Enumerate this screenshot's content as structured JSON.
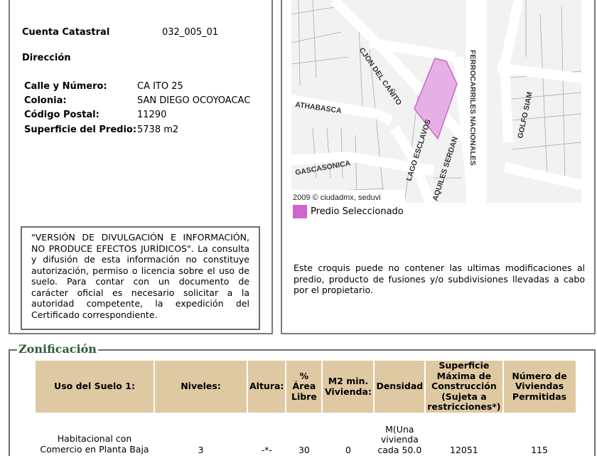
{
  "info": {
    "cuenta_label": "Cuenta Catastral",
    "cuenta_value": "032_005_01",
    "direccion_label": "Dirección",
    "fields": [
      {
        "label": "Calle y Número:",
        "value": "CA ITO 25"
      },
      {
        "label": "Colonia:",
        "value": "SAN DIEGO OCOYOACAC"
      },
      {
        "label": "Código Postal:",
        "value": "11290"
      },
      {
        "label": "Superficie del Predio:",
        "value": "5738 m2"
      }
    ],
    "notice": "\"VERSIÓN DE DIVULGACIÓN E INFORMACIÓN, NO PRODUCE EFECTOS JURÍDICOS\". La consulta y difusión de esta información no constituye autorización, permiso o licencia sobre el uso de suelo. Para contar con un documento de carácter oficial es necesario solicitar a la autoridad competente, la expedición del Certificado correspondiente."
  },
  "map": {
    "streets": [
      "CJON DEL CAÑITO",
      "ATHABASCA",
      "GASCASONICA",
      "LAGO ESCLAVOS",
      "AQUILES SERDAN",
      "FERROCARRILES NACIONALES",
      "GOLFO SIAM"
    ],
    "copyright": "2009 © ciudadmx, seduvi",
    "legend": "Predio Seleccionado",
    "highlight_color": "#cc66cc",
    "disclaimer": "Este croquis puede no contener las ultimas modificaciones al predio, producto de fusiones y/o subdivisiones llevadas a cabo por el propietario."
  },
  "zonificacion": {
    "title": "Zonificación",
    "headers": [
      "Uso del Suelo 1:",
      "Niveles:",
      "Altura:",
      "% Área Libre",
      "M2 min. Vivienda:",
      "Densidad",
      "Superficie Máxima de Construcción (Sujeta a restricciones*)",
      "Número de Viviendas Permitidas"
    ],
    "row": [
      "Habitacional con Comercio en Planta Baja",
      "3",
      "-*-",
      "30",
      "0",
      "M(Una vivienda cada 50.0",
      "12051",
      "115"
    ]
  }
}
